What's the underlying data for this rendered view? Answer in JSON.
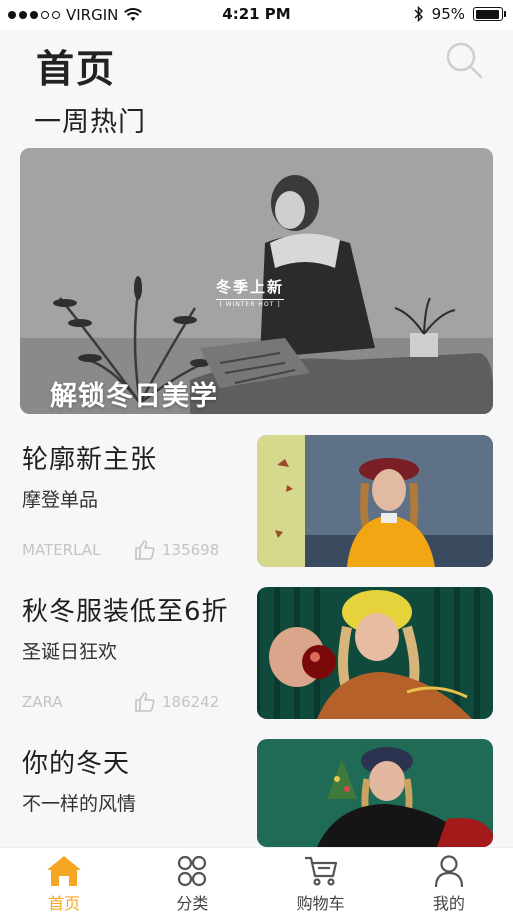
{
  "status_bar": {
    "carrier": "VIRGIN",
    "time": "4:21 PM",
    "battery": "95%",
    "battery_level": 0.95
  },
  "header": {
    "title": "首页"
  },
  "section": {
    "title": "一周热门"
  },
  "hero": {
    "title": "解锁冬日美学",
    "logo_main": "冬季上新",
    "logo_sub": "[ WINTER HOT ]"
  },
  "cards": [
    {
      "title": "轮廓新主张",
      "subtitle": "摩登单品",
      "brand": "MATERLAL",
      "likes": "135698"
    },
    {
      "title": "秋冬服装低至6折",
      "subtitle": "圣诞日狂欢",
      "brand": "ZARA",
      "likes": "186242"
    },
    {
      "title": "你的冬天",
      "subtitle": "不一样的风情"
    }
  ],
  "tabbar": {
    "accent": "#f5a623",
    "items": [
      {
        "label": "首页",
        "icon": "home-icon",
        "active": true
      },
      {
        "label": "分类",
        "icon": "category-icon",
        "active": false
      },
      {
        "label": "购物车",
        "icon": "cart-icon",
        "active": false
      },
      {
        "label": "我的",
        "icon": "user-icon",
        "active": false
      }
    ]
  }
}
